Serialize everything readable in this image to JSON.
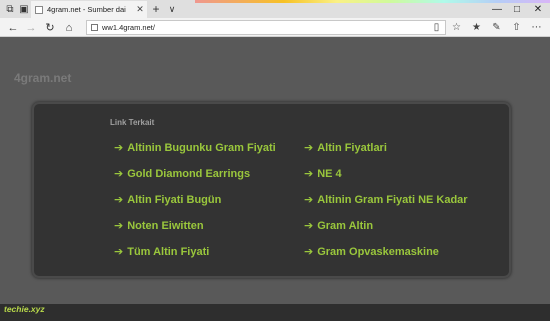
{
  "browser": {
    "tab": {
      "title": "4gram.net - Sumber dai",
      "close_icon": "close-icon"
    },
    "url": "ww1.4gram.net/"
  },
  "page": {
    "site_title": "4gram.net",
    "panel": {
      "heading": "Link Terkait",
      "arrow": "➔",
      "links_left": [
        "Altinin Bugunku Gram Fiyati",
        "Gold Diamond Earrings",
        "Altin Fiyati Bugün",
        "Noten Eiwitten",
        "Tüm Altin Fiyati"
      ],
      "links_right": [
        "Altin Fiyatlari",
        "NE 4",
        "Altinin Gram Fiyati NE Kadar",
        "Gram Altin",
        "Gram Opvaskemaskine"
      ]
    }
  },
  "watermark": "techie.xyz",
  "colors": {
    "link": "#9ac73c",
    "panel": "#333333",
    "page_bg": "#595959"
  }
}
